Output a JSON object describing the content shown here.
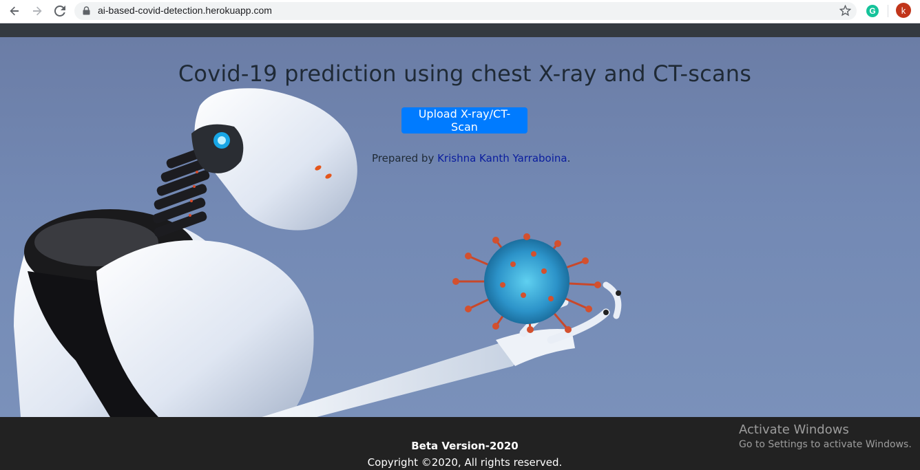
{
  "browser": {
    "url": "ai-based-covid-detection.herokuapp.com",
    "extension_letter": "G",
    "avatar_letter": "k",
    "icons": [
      "back-arrow-icon",
      "forward-arrow-icon",
      "reload-icon",
      "lock-icon",
      "star-icon"
    ]
  },
  "hero": {
    "title": "Covid-19 prediction using chest X-ray and CT-scans",
    "upload_label": "Upload X-ray/CT-Scan",
    "prepared_prefix": "Prepared by ",
    "author": "Krishna Kanth Yarraboina",
    "prepared_suffix": "."
  },
  "footer": {
    "beta": "Beta Version-2020",
    "copyright": "Copyright ©2020, All rights reserved."
  },
  "watermark": {
    "heading": "Activate Windows",
    "subtext": "Go to Settings to activate Windows."
  },
  "colors": {
    "primary_button": "#007bff",
    "navbar": "#343a40",
    "footer": "#222222",
    "link": "#0a1d9e"
  }
}
